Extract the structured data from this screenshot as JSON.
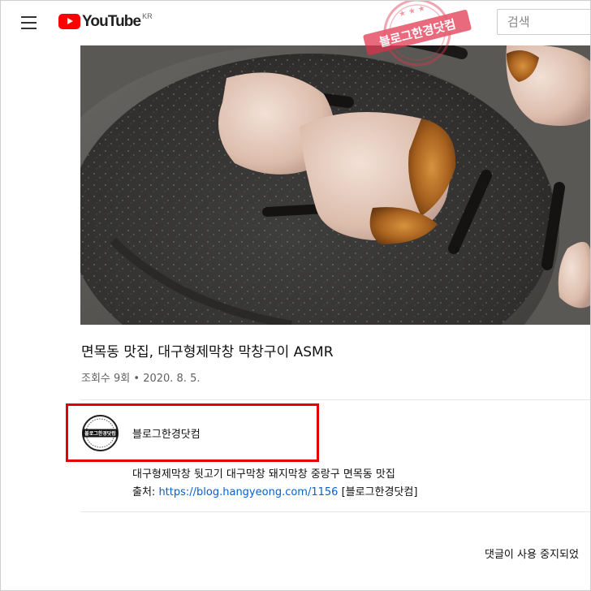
{
  "colors": {
    "brand_red": "#ff0000",
    "link_blue": "#065fd4",
    "highlight_red": "#e30000",
    "secondary_text": "#606060"
  },
  "header": {
    "logo_text": "YouTube",
    "region_code": "KR",
    "search_placeholder": "검색",
    "menu_icon": "hamburger-menu-icon"
  },
  "watermark": {
    "text": "블로그한경닷컴"
  },
  "video": {
    "title": "면목동 맛집, 대구형제막창 막창구이 ASMR",
    "views": "조회수 9회",
    "separator": "•",
    "date": "2020. 8. 5."
  },
  "channel": {
    "name": "블로그한경닷컴",
    "avatar_text": "블로그한경닷컴"
  },
  "description": {
    "line1": "대구형제막창 뒷고기 대구막창 돼지막창 중랑구 면목동 맛집",
    "source_label": "출처: ",
    "source_link": "https://blog.hangyeong.com/1156",
    "source_suffix": " [블로그한경닷컴]"
  },
  "comments": {
    "status": "댓글이 사용 중지되었"
  }
}
